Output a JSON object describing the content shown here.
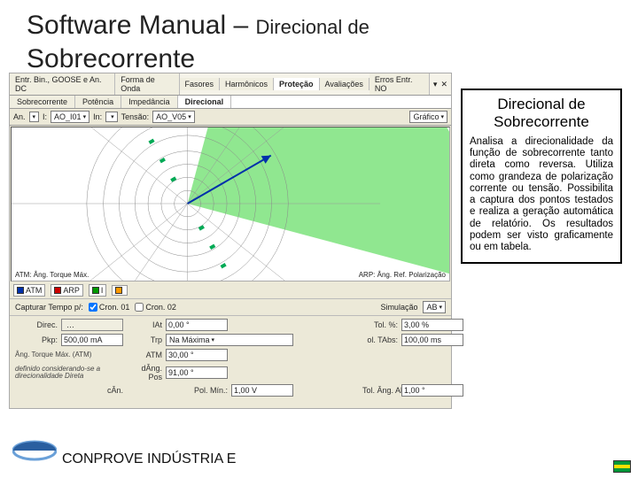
{
  "slide": {
    "title_main": "Software Manual – ",
    "title_sub": "Direcional de",
    "subtitle": "Sobrecorrente",
    "footer": "CONPROVE INDÚSTRIA E"
  },
  "description": {
    "title": "Direcional de Sobrecorrente",
    "text": "Analisa a direcionalidade da função de sobrecorrente tanto direta como reversa. Utiliza como grandeza de polarização corrente ou tensão. Possibilita a captura dos pontos testados e realiza a geração automática de relatório. Os resultados podem ser visto graficamente ou em tabela."
  },
  "app": {
    "tabs": [
      "Entr. Bin., GOOSE e An. DC",
      "Forma de Onda",
      "Fasores",
      "Harmônicos",
      "Proteção",
      "Avaliações",
      "Erros Entr. NO"
    ],
    "active_tab": 4,
    "close_icon": "✕",
    "pin_icon": "▾",
    "subtabs": [
      "Sobrecorrente",
      "Potência",
      "Impedância",
      "Direcional"
    ],
    "active_subtab": 3,
    "toolbar": {
      "an_label": "An.",
      "an_sel": "▾",
      "i_label": "I:",
      "i_sel": "AO_I01",
      "in_label": "In:",
      "in_sel": "",
      "tensao_label": "Tensão:",
      "tensao_sel": "AO_V05",
      "grafico": "Gráfico"
    },
    "chart": {
      "atm_left": "ATM: Âng. Torque Máx.",
      "atm_right": "ARP: Âng. Ref. Polarização"
    },
    "legend": {
      "atm_btn": "ATM",
      "arp_btn": "ARP",
      "l3": "I",
      "l4": ""
    },
    "capture": {
      "label": "Capturar Tempo p/:",
      "cron1": "Cron. 01",
      "cron2": "Cron. 02",
      "sim_label": "Simulação",
      "sim_sel": "AB"
    },
    "fields": {
      "direc_label": "Direc.",
      "direc_btn": "…",
      "iat_label": "IAt",
      "iat_val": "0,00 °",
      "tol_pct_label": "Tol. %:",
      "tol_pct_val": "3,00 %",
      "pkp_label": "Pkp:",
      "pkp_val": "500,00 mA",
      "trp_label": "Trp",
      "trp_val": "Na Máxima",
      "tol_tabs_label": "ol. TAbs:",
      "tol_tabs_val": "100,00 ms",
      "atm_label": "Âng. Torque Máx. (ATM)",
      "atm_note": "definido considerando-se a direcionalidade Direta",
      "atm_field_label": "ATM",
      "atm_val": "30,00 °",
      "dang_label": "dÂng. Pos",
      "dang_val": "91,00 °",
      "can_label": "cÂn.",
      "pol_min_label": "Pol. Mín.:",
      "pol_min_val": "1,00 V",
      "tol_ang_label": "Tol. Âng. Abs:",
      "tol_ang_val": "1,00 °"
    }
  },
  "chart_data": {
    "type": "polar",
    "title": "Direcional",
    "atm_angle_deg": 30,
    "half_plane_span_deg": 180,
    "rings": 7,
    "highlight_region": "forward (ATM+90° to ATM-90°)",
    "sector_color": "#7de37d"
  }
}
